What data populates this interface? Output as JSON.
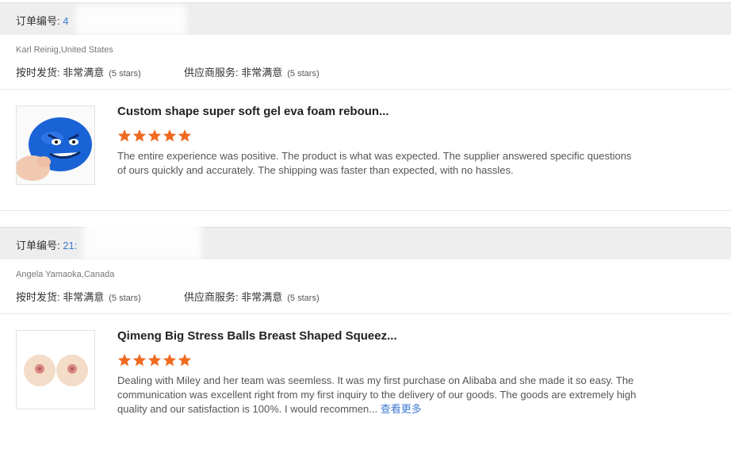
{
  "reviews": [
    {
      "order_label": "订单编号:",
      "order_number": "4",
      "buyer": "Karl Reinig,United States",
      "ship_label": "按时发货:",
      "ship_value": "非常满意",
      "ship_stars": "(5 stars)",
      "service_label": "供应商服务:",
      "service_value": "非常满意",
      "service_stars": "(5 stars)",
      "product_title": "Custom shape super soft gel eva foam reboun...",
      "rating": 5,
      "text": "The entire experience was positive. The product is what was expected. The supplier answered specific questions of ours quickly and accurately. The shipping was faster than expected, with no hassles.",
      "more_label": ""
    },
    {
      "order_label": "订单编号:",
      "order_number": "21:",
      "buyer": "Angela Yamaoka,Canada",
      "ship_label": "按时发货:",
      "ship_value": "非常满意",
      "ship_stars": "(5 stars)",
      "service_label": "供应商服务:",
      "service_value": "非常满意",
      "service_stars": "(5 stars)",
      "product_title": "Qimeng Big Stress Balls Breast Shaped Squeez...",
      "rating": 5,
      "text": "Dealing with Miley and her team was seemless. It was my first purchase on Alibaba and she made it so easy. The communication was excellent right from my first inquiry to the delivery of our goods. The goods are extremely high quality and our satisfaction is 100%. I would recommen...",
      "more_label": "查看更多"
    }
  ],
  "colors": {
    "star": "#f06a1f",
    "link": "#3d7ad0",
    "bar": "#eeeeee"
  }
}
